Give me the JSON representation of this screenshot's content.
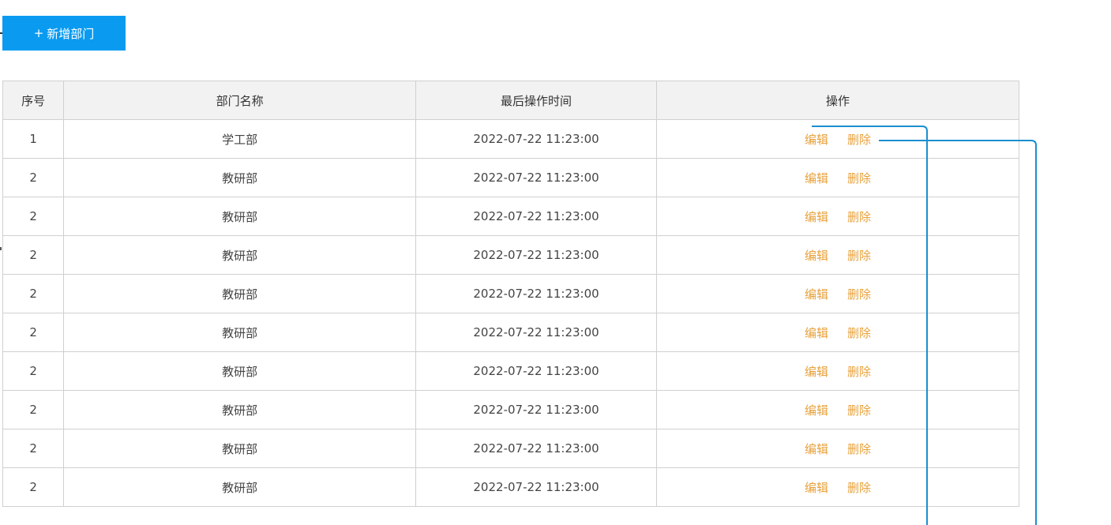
{
  "toolbar": {
    "add_button_plus": "+",
    "add_button_label": "新增部门"
  },
  "table": {
    "headers": {
      "seq": "序号",
      "name": "部门名称",
      "time": "最后操作时间",
      "ops": "操作"
    },
    "rows": [
      {
        "seq": "1",
        "name": "学工部",
        "time": "2022-07-22 11:23:00",
        "edit": "编辑",
        "delete": "删除"
      },
      {
        "seq": "2",
        "name": "教研部",
        "time": "2022-07-22 11:23:00",
        "edit": "编辑",
        "delete": "删除"
      },
      {
        "seq": "2",
        "name": "教研部",
        "time": "2022-07-22 11:23:00",
        "edit": "编辑",
        "delete": "删除"
      },
      {
        "seq": "2",
        "name": "教研部",
        "time": "2022-07-22 11:23:00",
        "edit": "编辑",
        "delete": "删除"
      },
      {
        "seq": "2",
        "name": "教研部",
        "time": "2022-07-22 11:23:00",
        "edit": "编辑",
        "delete": "删除"
      },
      {
        "seq": "2",
        "name": "教研部",
        "time": "2022-07-22 11:23:00",
        "edit": "编辑",
        "delete": "删除"
      },
      {
        "seq": "2",
        "name": "教研部",
        "time": "2022-07-22 11:23:00",
        "edit": "编辑",
        "delete": "删除"
      },
      {
        "seq": "2",
        "name": "教研部",
        "time": "2022-07-22 11:23:00",
        "edit": "编辑",
        "delete": "删除"
      },
      {
        "seq": "2",
        "name": "教研部",
        "time": "2022-07-22 11:23:00",
        "edit": "编辑",
        "delete": "删除"
      },
      {
        "seq": "2",
        "name": "教研部",
        "time": "2022-07-22 11:23:00",
        "edit": "编辑",
        "delete": "删除"
      }
    ]
  },
  "colors": {
    "primary_button": "#0a9bf1",
    "action_link": "#e8a13b",
    "annotation_line": "#1a8fcf",
    "header_bg": "#f2f2f2",
    "border": "#d0d0d0"
  }
}
